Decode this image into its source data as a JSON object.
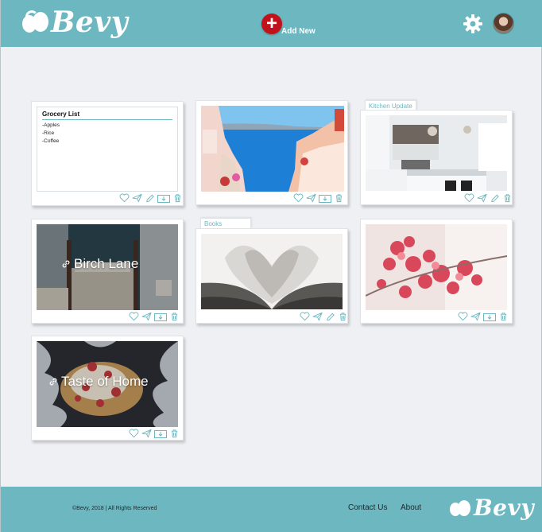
{
  "header": {
    "logo_text": "Bevy",
    "add_new_label": "Add New",
    "add_symbol": "+"
  },
  "cards": {
    "grocery": {
      "title": "Grocery List",
      "items": [
        "-Apples",
        "-Rice",
        "-Coffee"
      ]
    },
    "kitchen_tab": "Kitchen Update",
    "books_tab": "Books",
    "birch_lane": "Birch Lane",
    "taste_of_home": "Taste of Home"
  },
  "footer": {
    "copyright": "©Bevy, 2018 | All Rights Reserved",
    "contact": "Contact Us",
    "about": "About",
    "logo_text": "Bevy"
  },
  "colors": {
    "brand": "#6cb7c0",
    "add_button": "#c1121b",
    "background": "#eff0f4"
  },
  "icons": [
    "heart-icon",
    "share-icon",
    "edit-icon",
    "download-icon",
    "trash-icon",
    "gear-icon",
    "link-icon"
  ]
}
